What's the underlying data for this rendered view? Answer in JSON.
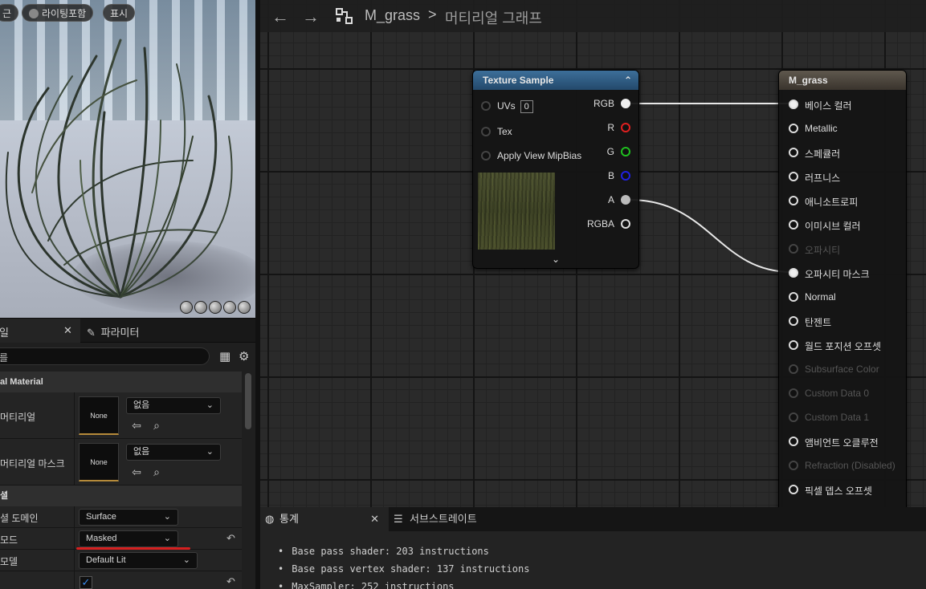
{
  "viewport": {
    "buttons": [
      "근",
      "라이팅포함",
      "표시"
    ]
  },
  "details": {
    "tab_details_label": "일",
    "tab_close": "✕",
    "tab_params_label": "파라미터",
    "search_value": "를",
    "categories": [
      {
        "label": "al Material"
      },
      {
        "label": "셜"
      }
    ],
    "material_rows": [
      {
        "label": "머티리얼",
        "thumb": "None",
        "combo": "없음"
      },
      {
        "label": "머티리얼 마스크",
        "thumb": "None",
        "combo": "없음"
      }
    ],
    "props": [
      {
        "label": "셜 도메인",
        "value": "Surface"
      },
      {
        "label": "모드",
        "value": "Masked"
      },
      {
        "label": "모델",
        "value": "Default Lit"
      }
    ],
    "checkbox_checked": "✓"
  },
  "graph": {
    "breadcrumb_asset": "M_grass",
    "breadcrumb_sep": ">",
    "breadcrumb_graph": "머티리얼 그래프",
    "texture_node": {
      "title": "Texture Sample",
      "inputs": [
        {
          "label": "UVs",
          "value": "0"
        },
        {
          "label": "Tex"
        },
        {
          "label": "Apply View MipBias"
        }
      ],
      "outputs": [
        {
          "label": "RGB",
          "color": "#eeeeee"
        },
        {
          "label": "R",
          "color": "#e02020"
        },
        {
          "label": "G",
          "color": "#20c020"
        },
        {
          "label": "B",
          "color": "#2020e0"
        },
        {
          "label": "A",
          "color": "#bbbbbb"
        },
        {
          "label": "RGBA",
          "color": "#dddddd"
        }
      ]
    },
    "material_node": {
      "title": "M_grass",
      "pins": [
        {
          "label": "베이스 컬러",
          "connected": true,
          "dim": false
        },
        {
          "label": "Metallic",
          "connected": false,
          "dim": false
        },
        {
          "label": "스페큘러",
          "connected": false,
          "dim": false
        },
        {
          "label": "러프니스",
          "connected": false,
          "dim": false
        },
        {
          "label": "애니소트로피",
          "connected": false,
          "dim": false
        },
        {
          "label": "이미시브 컬러",
          "connected": false,
          "dim": false
        },
        {
          "label": "오파시티",
          "connected": false,
          "dim": true
        },
        {
          "label": "오파시티 마스크",
          "connected": true,
          "dim": false
        },
        {
          "label": "Normal",
          "connected": false,
          "dim": false
        },
        {
          "label": "탄젠트",
          "connected": false,
          "dim": false
        },
        {
          "label": "월드 포지션 오프셋",
          "connected": false,
          "dim": false
        },
        {
          "label": "Subsurface Color",
          "connected": false,
          "dim": true
        },
        {
          "label": "Custom Data 0",
          "connected": false,
          "dim": true
        },
        {
          "label": "Custom Data 1",
          "connected": false,
          "dim": true
        },
        {
          "label": "앰비언트 오클루전",
          "connected": false,
          "dim": false
        },
        {
          "label": "Refraction (Disabled)",
          "connected": false,
          "dim": true
        },
        {
          "label": "픽셀 뎁스 오프셋",
          "connected": false,
          "dim": false
        }
      ]
    }
  },
  "stats": {
    "tab_stats_label": "통계",
    "tab_close": "✕",
    "tab_substrate_label": "서브스트레이트",
    "lines": [
      "Base pass shader: 203 instructions",
      "Base pass vertex shader: 137 instructions",
      "MaxSampler: 252 instructions"
    ]
  },
  "colors": {
    "texture_header": "#2f5e87",
    "material_header": "#4e473e",
    "annotation_underline": "#d61f1f"
  }
}
